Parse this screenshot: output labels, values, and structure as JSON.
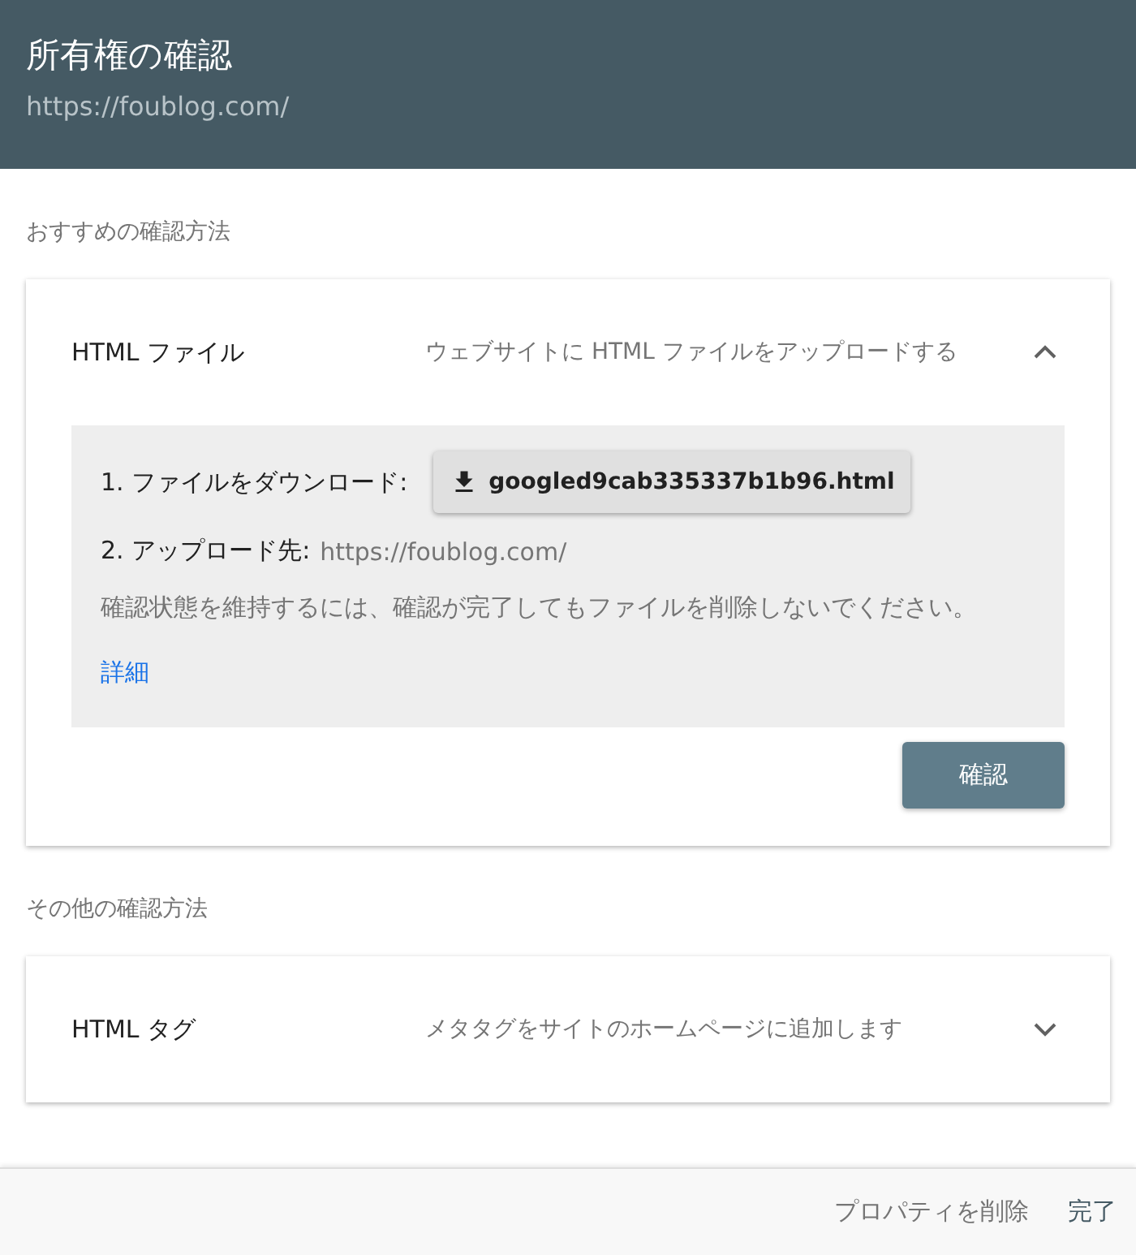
{
  "header": {
    "title": "所有権の確認",
    "subtitle": "https://foublog.com/"
  },
  "sections": [
    {
      "heading": "おすすめの確認方法",
      "methods": [
        {
          "title": "HTML ファイル",
          "description": "ウェブサイトに HTML ファイルをアップロードする",
          "expanded": true,
          "body": {
            "download_label": "1. ファイルをダウンロード:",
            "download_file": "googled9cab335337b1b96.html",
            "upload_label": "2. アップロード先:",
            "upload_url": "https://foublog.com/",
            "note": "確認状態を維持するには、確認が完了してもファイルを削除しないでください。",
            "link": "詳細",
            "verify_button": "確認"
          }
        }
      ]
    },
    {
      "heading": "その他の確認方法",
      "methods": [
        {
          "title": "HTML タグ",
          "description": "メタタグをサイトのホームページに追加します",
          "expanded": false
        }
      ]
    }
  ],
  "footer": {
    "buttons": [
      "プロパティを削除",
      "完了"
    ]
  }
}
